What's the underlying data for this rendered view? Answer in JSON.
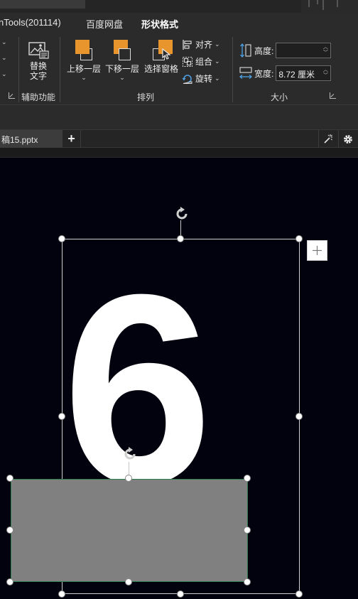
{
  "ribbon": {
    "tabs": [
      {
        "label": "nTools(201114)",
        "active": false
      },
      {
        "label": "百度网盘",
        "active": false
      },
      {
        "label": "形状格式",
        "active": true
      }
    ],
    "groups": {
      "accessibility": {
        "label": "辅助功能",
        "alt_text_button": {
          "line1": "替换",
          "line2": "文字",
          "icon": "alt-text-icon"
        }
      },
      "arrange": {
        "label": "排列",
        "bring_forward": {
          "label": "上移一层",
          "icon": "bring-forward-icon"
        },
        "send_backward": {
          "label": "下移一层",
          "icon": "send-backward-icon"
        },
        "selection_pane": {
          "label": "选择窗格",
          "icon": "selection-pane-icon"
        },
        "align": {
          "label": "对齐",
          "icon": "align-icon"
        },
        "group": {
          "label": "组合",
          "icon": "group-icon"
        },
        "rotate": {
          "label": "旋转",
          "icon": "rotate-icon"
        }
      },
      "size": {
        "label": "大小",
        "height": {
          "label": "高度:",
          "value": "",
          "icon": "height-icon"
        },
        "width": {
          "label": "宽度:",
          "value": "8.72 厘米",
          "icon": "width-icon"
        }
      }
    },
    "accent_color": "#e8952e"
  },
  "document_tabs": {
    "active_file": "稿15.pptx",
    "add_tab_symbol": "+",
    "right_icons": [
      "magic-wand-icon",
      "gear-icon"
    ]
  },
  "slide": {
    "background_color": "#02020e",
    "digit_text": "6",
    "gray_rect_color": "#808080"
  }
}
